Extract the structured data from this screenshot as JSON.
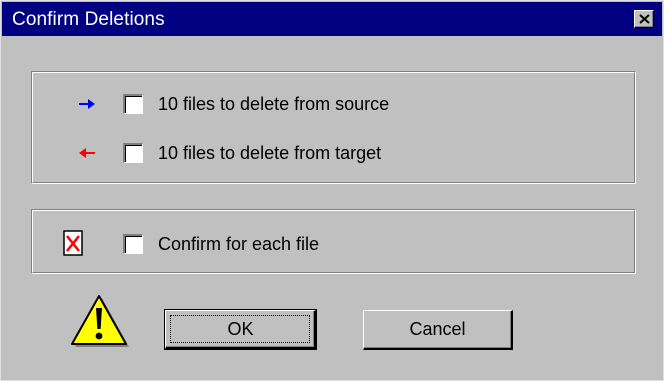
{
  "window": {
    "title": "Confirm Deletions"
  },
  "icons": {
    "source_arrow": "right-arrow-icon",
    "target_arrow": "left-arrow-icon",
    "file_x": "file-delete-icon",
    "warning": "warning-icon",
    "close": "close-icon"
  },
  "colors": {
    "titlebar": "#000080",
    "source_arrow": "#0000ff",
    "target_arrow": "#ff0000",
    "warning_fill": "#ffff00"
  },
  "deletions": {
    "source_label": "10 files to delete from source",
    "target_label": "10 files to delete from target",
    "source_checked": false,
    "target_checked": false
  },
  "confirm": {
    "label": "Confirm for each file",
    "checked": false
  },
  "buttons": {
    "ok": "OK",
    "cancel": "Cancel"
  }
}
